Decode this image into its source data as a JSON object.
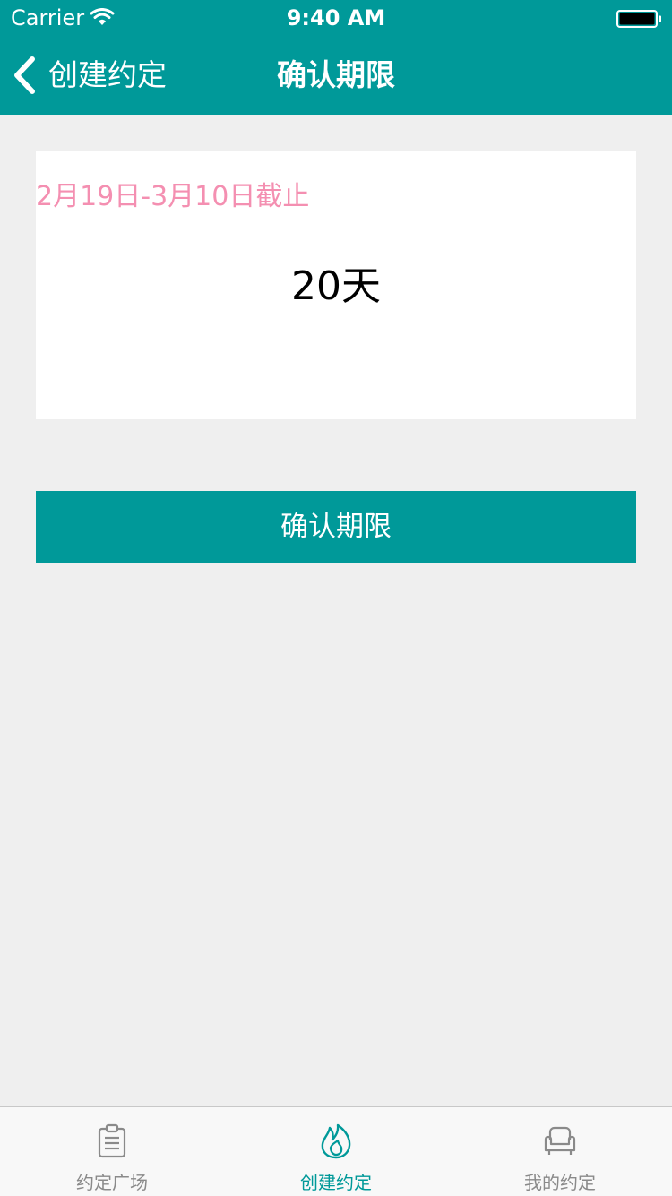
{
  "status_bar": {
    "carrier": "Carrier",
    "time": "9:40 AM"
  },
  "nav": {
    "back_label": "创建约定",
    "title": "确认期限"
  },
  "period": {
    "range": "2月19日-3月10日截止",
    "days": "20天"
  },
  "confirm_button": {
    "label": "确认期限"
  },
  "tabs": [
    {
      "label": "约定广场",
      "icon": "clipboard-icon",
      "active": false
    },
    {
      "label": "创建约定",
      "icon": "flame-icon",
      "active": true
    },
    {
      "label": "我的约定",
      "icon": "armchair-icon",
      "active": false
    }
  ],
  "colors": {
    "primary": "#009999",
    "range_text": "#f48fb1",
    "background": "#efefef",
    "tab_inactive": "#8a8a8a"
  }
}
